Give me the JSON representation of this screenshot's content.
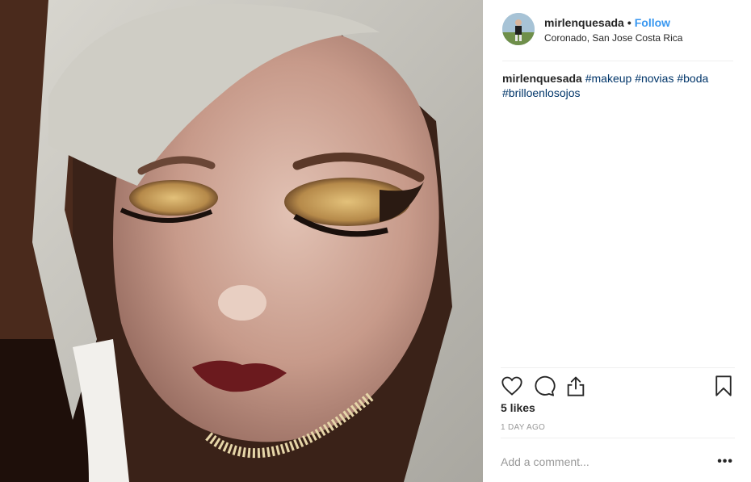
{
  "post": {
    "username": "mirlenquesada",
    "separator": "•",
    "follow_label": "Follow",
    "location": "Coronado, San Jose Costa Rica"
  },
  "caption": {
    "username": "mirlenquesada",
    "hashtags": [
      "#makeup",
      "#novias",
      "#boda",
      "#brilloenlosojos"
    ]
  },
  "actions": {
    "icons": [
      "heart-icon",
      "comment-icon",
      "share-icon",
      "bookmark-icon"
    ]
  },
  "likes": "5 likes",
  "timestamp": "1 DAY AGO",
  "comment": {
    "placeholder": "Add a comment...",
    "more_label": "•••"
  },
  "colors": {
    "link_blue": "#3897f0",
    "hashtag": "#003569",
    "muted": "#999999",
    "divider": "#efefef"
  }
}
